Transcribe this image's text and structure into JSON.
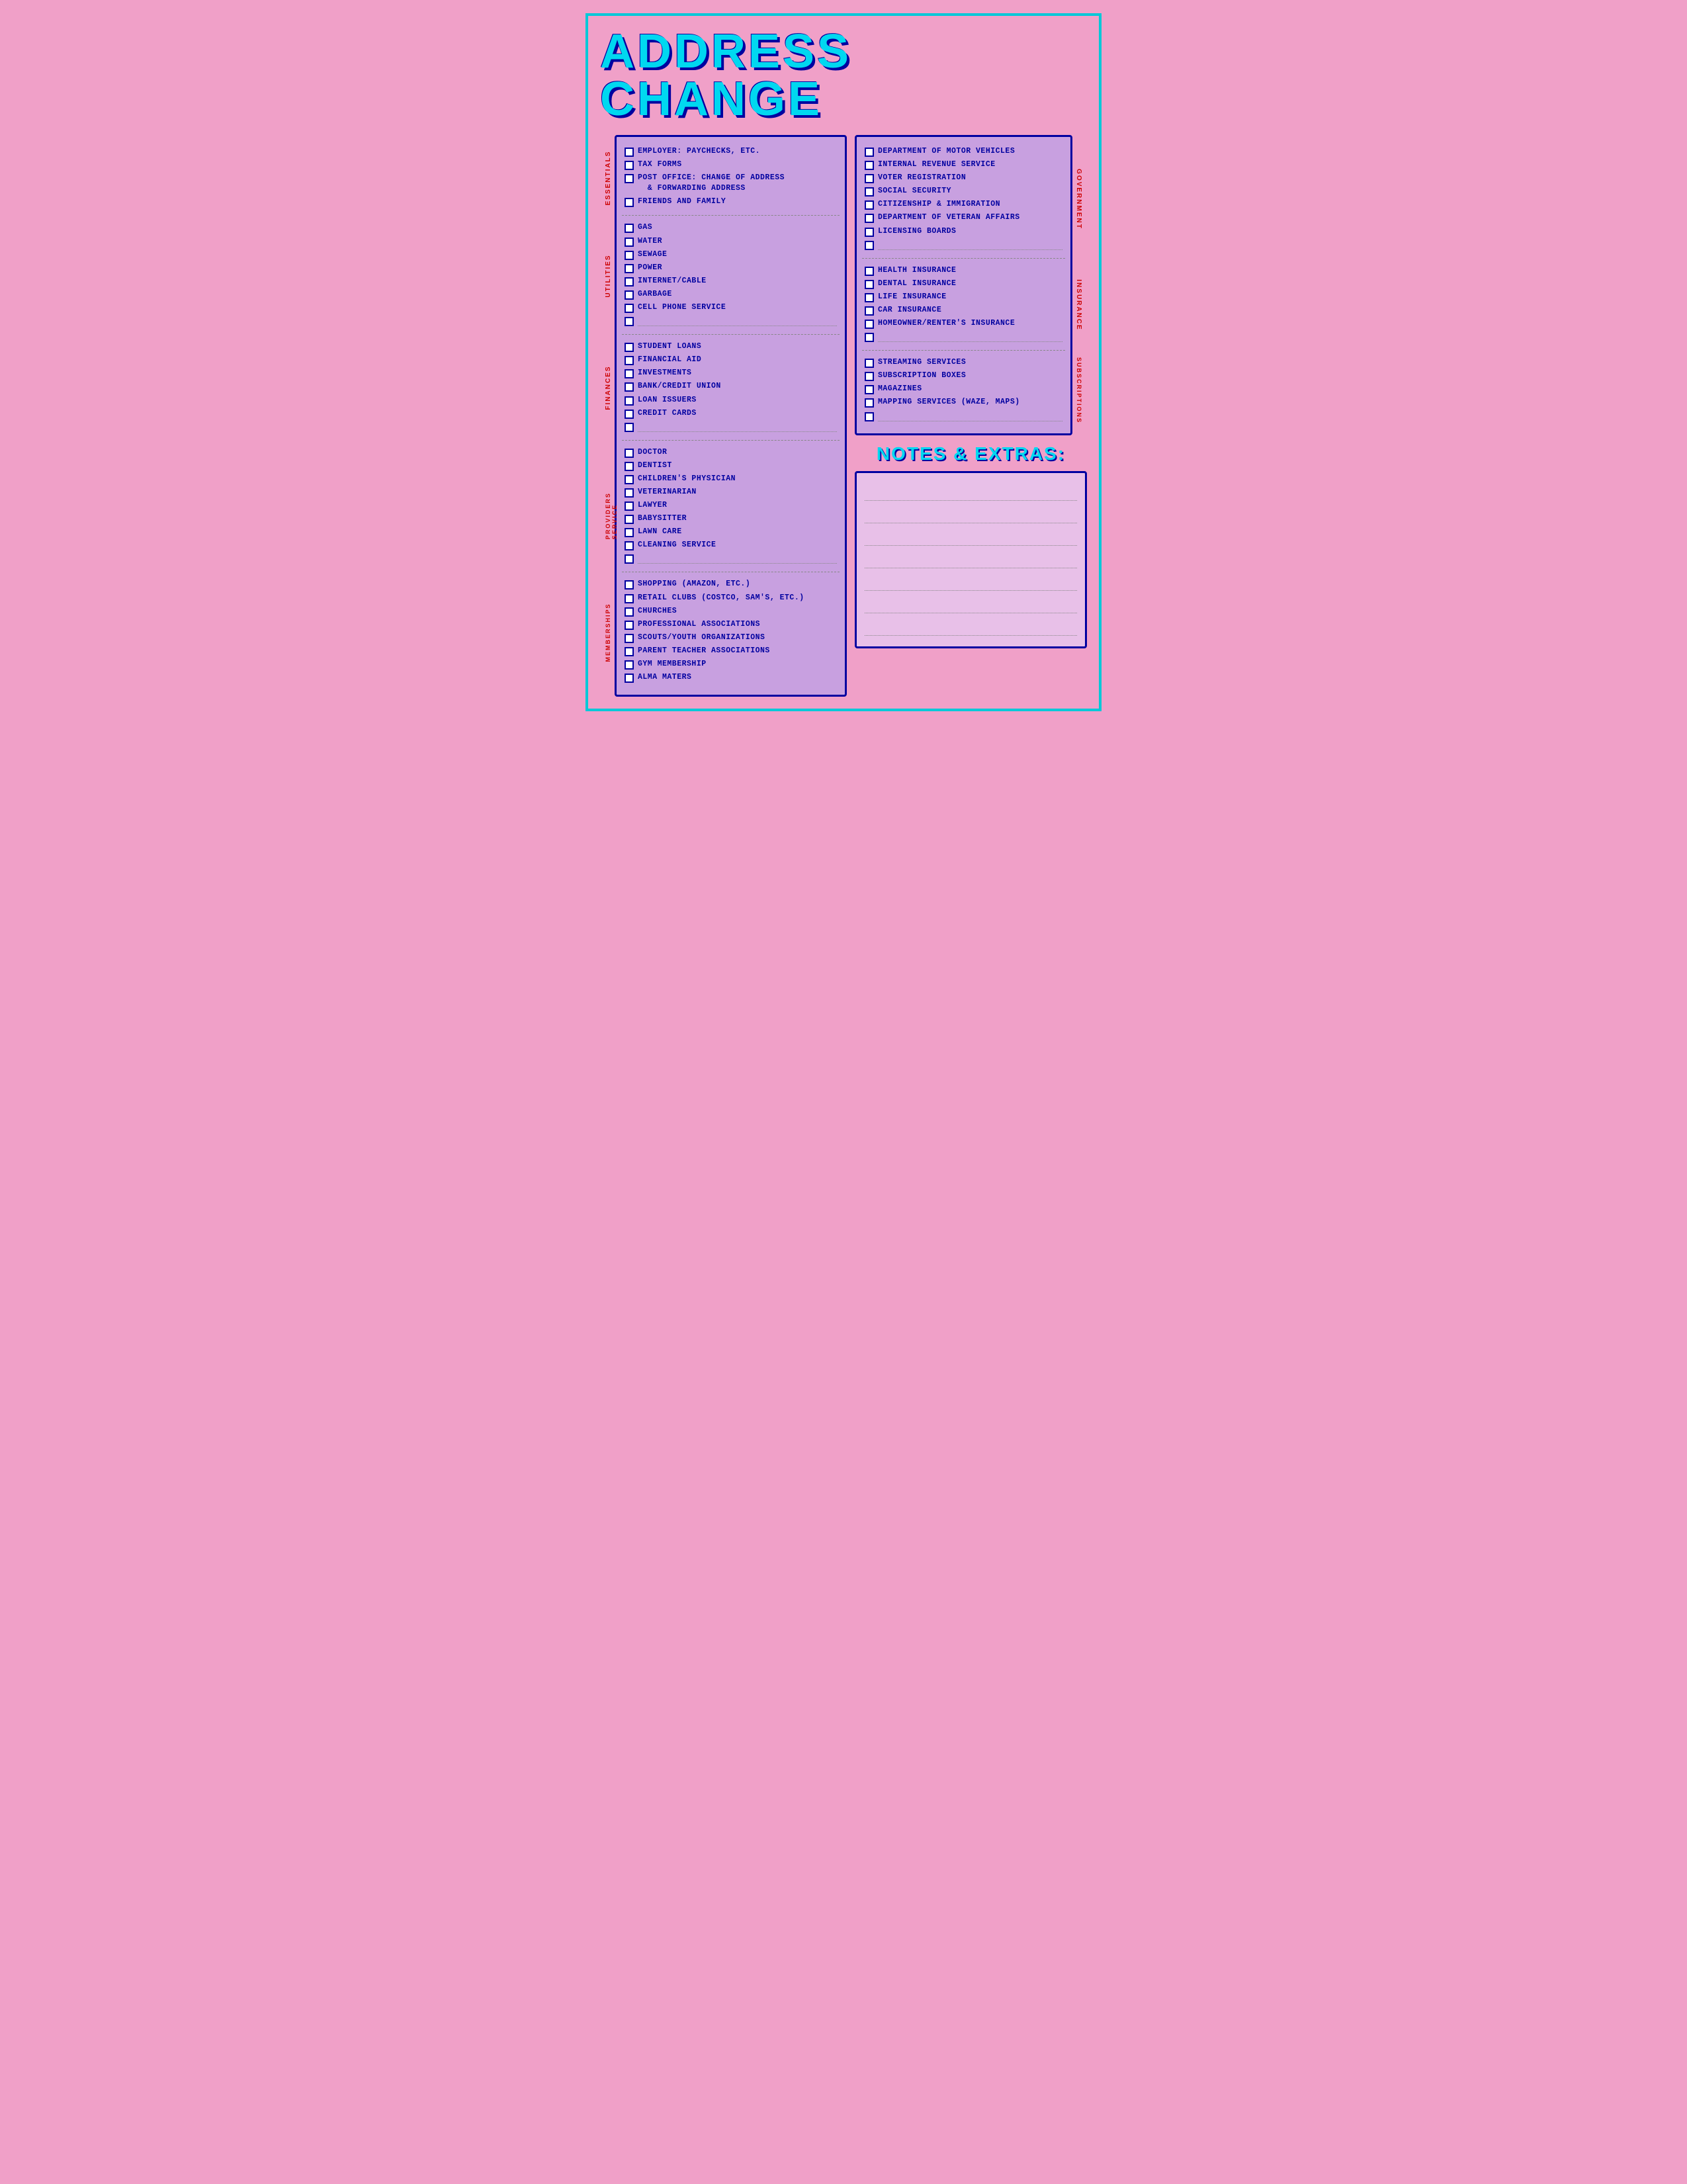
{
  "title": "ADDRESS CHANGE",
  "left_sections": [
    {
      "label": "ESSENTIALS",
      "items": [
        "EMPLOYER: PAYCHECKS, ETC.",
        "TAX FORMS",
        "POST OFFICE: CHANGE OF ADDRESS & FORWARDING ADDRESS",
        "FRIENDS AND FAMILY"
      ],
      "has_blank": false
    },
    {
      "label": "UTILITIES",
      "items": [
        "GAS",
        "WATER",
        "SEWAGE",
        "POWER",
        "INTERNET/CABLE",
        "GARBAGE",
        "CELL PHONE SERVICE"
      ],
      "has_blank": true
    },
    {
      "label": "FINANCES",
      "items": [
        "STUDENT LOANS",
        "FINANCIAL AID",
        "INVESTMENTS",
        "BANK/CREDIT UNION",
        "LOAN ISSUERS",
        "CREDIT CARDS"
      ],
      "has_blank": true
    },
    {
      "label": "SERVICE PROVIDERS",
      "items": [
        "DOCTOR",
        "DENTIST",
        "CHILDREN'S PHYSICIAN",
        "VETERINARIAN",
        "LAWYER",
        "BABYSITTER",
        "LAWN CARE",
        "CLEANING SERVICE"
      ],
      "has_blank": true
    },
    {
      "label": "MEMBERSHIPS",
      "items": [
        "SHOPPING (AMAZON, ETC.)",
        "RETAIL CLUBS (COSTCO, SAM'S, ETC.)",
        "CHURCHES",
        "PROFESSIONAL ASSOCIATIONS",
        "SCOUTS/YOUTH ORGANIZATIONS",
        "PARENT TEACHER ASSOCIATIONS",
        "GYM MEMBERSHIP",
        "ALMA MATERS"
      ],
      "has_blank": false
    }
  ],
  "right_sections": [
    {
      "label": "GOVERNMENT",
      "items": [
        "DEPARTMENT OF MOTOR VEHICLES",
        "INTERNAL REVENUE SERVICE",
        "VOTER REGISTRATION",
        "SOCIAL SECURITY",
        "CITIZENSHIP & IMMIGRATION",
        "DEPARTMENT OF VETERAN AFFAIRS",
        "LICENSING BOARDS"
      ],
      "has_blank": true
    },
    {
      "label": "INSURANCE",
      "items": [
        "HEALTH INSURANCE",
        "DENTAL INSURANCE",
        "LIFE INSURANCE",
        "CAR INSURANCE",
        "HOMEOWNER/RENTER'S INSURANCE"
      ],
      "has_blank": true
    },
    {
      "label": "SUBSCRIPTIONS",
      "items": [
        "STREAMING SERVICES",
        "SUBSCRIPTION BOXES",
        "MAGAZINES",
        "MAPPING SERVICES (WAZE, MAPS)"
      ],
      "has_blank": true
    }
  ],
  "notes": {
    "title": "NOTES & EXTRAS:",
    "lines": 7
  }
}
